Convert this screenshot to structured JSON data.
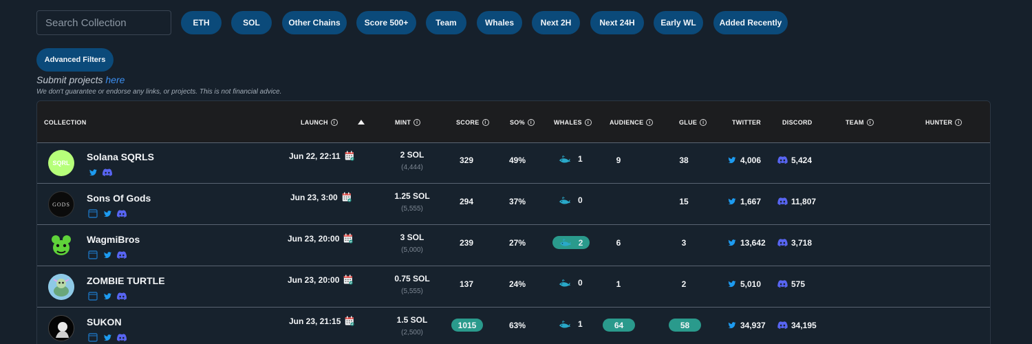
{
  "search": {
    "placeholder": "Search Collection"
  },
  "filters": [
    "ETH",
    "SOL",
    "Other Chains",
    "Score 500+",
    "Team",
    "Whales",
    "Next 2H",
    "Next 24H",
    "Early WL",
    "Added Recently"
  ],
  "advanced_filters": "Advanced Filters",
  "submit": {
    "text": "Submit projects ",
    "link": "here"
  },
  "disclaimer": "We don't guarantee or endorse any links, or projects. This is not financial advice.",
  "columns": {
    "collection": "COLLECTION",
    "launch": "LAUNCH",
    "mint": "MINT",
    "score": "SCORE",
    "so": "SO%",
    "whales": "WHALES",
    "audience": "AUDIENCE",
    "glue": "GLUE",
    "twitter": "TWITTER",
    "discord": "DISCORD",
    "team": "TEAM",
    "hunter": "HUNTER"
  },
  "info_glyph": "i",
  "avatar_text": {
    "sqrl": "SQRL",
    "gods": "GODS"
  },
  "colors": {
    "accent": "#0b4a7a",
    "highlight": "#2a9a8c",
    "twitter": "#1d9bf0",
    "discord": "#5865f2",
    "link": "#3b8ef0"
  },
  "rows": [
    {
      "name": "Solana SQRLS",
      "launch": "Jun 22, 22:11",
      "mint": "2 SOL",
      "supply": "(4,444)",
      "score": "329",
      "so": "49%",
      "whales": "1",
      "audience": "9",
      "glue": "38",
      "twitter": "4,006",
      "discord": "5,424"
    },
    {
      "name": "Sons Of Gods",
      "launch": "Jun 23, 3:00",
      "mint": "1.25 SOL",
      "supply": "(5,555)",
      "score": "294",
      "so": "37%",
      "whales": "0",
      "audience": "",
      "glue": "15",
      "twitter": "1,667",
      "discord": "11,807"
    },
    {
      "name": "WagmiBros",
      "launch": "Jun 23, 20:00",
      "mint": "3 SOL",
      "supply": "(5,000)",
      "score": "239",
      "so": "27%",
      "whales": "2",
      "audience": "6",
      "glue": "3",
      "twitter": "13,642",
      "discord": "3,718"
    },
    {
      "name": "ZOMBIE TURTLE",
      "launch": "Jun 23, 20:00",
      "mint": "0.75 SOL",
      "supply": "(5,555)",
      "score": "137",
      "so": "24%",
      "whales": "0",
      "audience": "1",
      "glue": "2",
      "twitter": "5,010",
      "discord": "575"
    },
    {
      "name": "SUKON",
      "launch": "Jun 23, 21:15",
      "mint": "1.5 SOL",
      "supply": "(2,500)",
      "score": "1015",
      "so": "63%",
      "whales": "1",
      "audience": "64",
      "glue": "58",
      "twitter": "34,937",
      "discord": "34,195"
    }
  ]
}
